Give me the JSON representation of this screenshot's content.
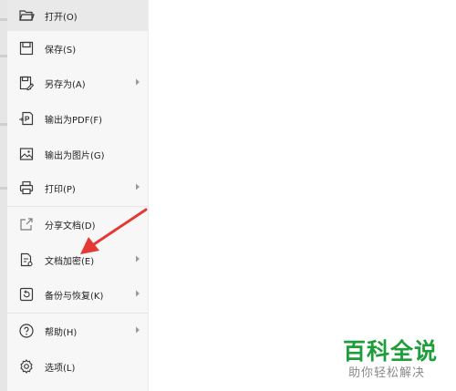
{
  "menu": {
    "items": [
      {
        "label": "打开(O)",
        "icon": "folder-open-icon",
        "submenu": false,
        "selected": true
      },
      {
        "label": "保存(S)",
        "icon": "save-icon",
        "submenu": false
      },
      {
        "label": "另存为(A)",
        "icon": "save-as-icon",
        "submenu": true
      },
      {
        "label": "输出为PDF(F)",
        "icon": "export-pdf-icon",
        "submenu": false
      },
      {
        "label": "输出为图片(G)",
        "icon": "export-image-icon",
        "submenu": false
      },
      {
        "label": "打印(P)",
        "icon": "printer-icon",
        "submenu": true
      },
      {
        "label": "分享文档(D)",
        "icon": "share-icon",
        "submenu": false
      },
      {
        "label": "文档加密(E)",
        "icon": "document-lock-icon",
        "submenu": true
      },
      {
        "label": "备份与恢复(K)",
        "icon": "backup-restore-icon",
        "submenu": true
      },
      {
        "label": "帮助(H)",
        "icon": "help-icon",
        "submenu": true
      },
      {
        "label": "选项(L)",
        "icon": "gear-icon",
        "submenu": false
      }
    ]
  },
  "watermark": {
    "title": "百科全说",
    "subtitle": "助你轻松解决"
  },
  "colors": {
    "menu_bg": "#f7f7f7",
    "selected_bg": "#e9e9e9",
    "icon": "#3a3a3a",
    "annotation_arrow": "#e53935",
    "watermark_green": "#1e9e3a",
    "watermark_gray": "#8a8a8a"
  }
}
